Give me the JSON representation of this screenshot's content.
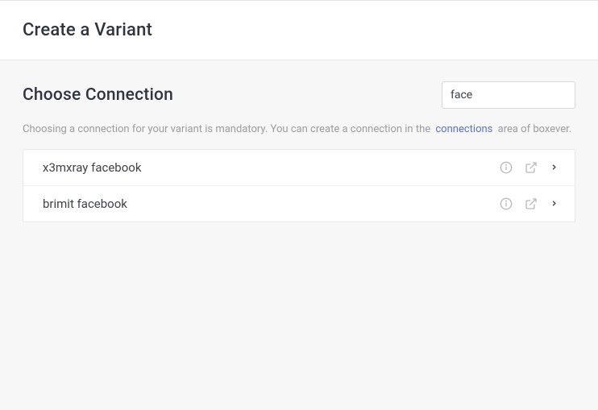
{
  "header": {
    "title": "Create a Variant"
  },
  "section": {
    "title": "Choose Connection",
    "search_value": "face",
    "description_prefix": "Choosing a connection for your variant is mandatory. You can create a connection in the",
    "description_link": "connections",
    "description_suffix": "area of boxever."
  },
  "connections": [
    {
      "label": "x3mxray facebook"
    },
    {
      "label": "brimit facebook"
    }
  ]
}
